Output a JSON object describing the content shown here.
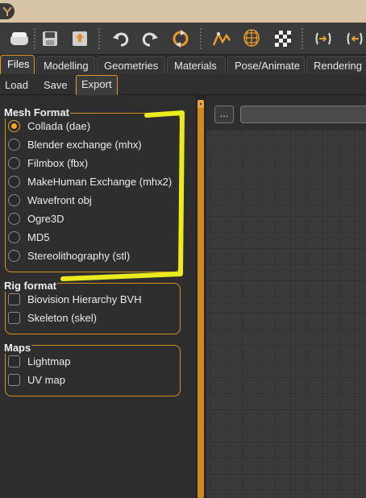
{
  "toolbar": {
    "buttons": [
      "undo-icon",
      "redo-icon",
      "reset-icon",
      "pose-icon",
      "wireframe-icon",
      "checker-icon",
      "front-view-icon",
      "back-view-icon"
    ]
  },
  "tabs": {
    "main": [
      {
        "label": "Files"
      },
      {
        "label": "Modelling"
      },
      {
        "label": "Geometries"
      },
      {
        "label": "Materials"
      },
      {
        "label": "Pose/Animate"
      },
      {
        "label": "Rendering"
      }
    ],
    "sub": [
      {
        "label": "Load"
      },
      {
        "label": "Save"
      },
      {
        "label": "Export"
      }
    ]
  },
  "mesh_format": {
    "title": "Mesh Format",
    "options": [
      {
        "label": "Collada (dae)",
        "selected": true
      },
      {
        "label": "Blender exchange (mhx)"
      },
      {
        "label": "Filmbox (fbx)"
      },
      {
        "label": "MakeHuman Exchange (mhx2)"
      },
      {
        "label": "Wavefront obj"
      },
      {
        "label": "Ogre3D"
      },
      {
        "label": "MD5"
      },
      {
        "label": "Stereolithography (stl)"
      }
    ]
  },
  "rig_format": {
    "title": "Rig format",
    "options": [
      {
        "label": "Biovision Hierarchy BVH"
      },
      {
        "label": "Skeleton (skel)"
      }
    ]
  },
  "maps": {
    "title": "Maps",
    "options": [
      {
        "label": "Lightmap"
      },
      {
        "label": "UV map"
      }
    ]
  },
  "export_path": {
    "browse_label": "...",
    "value": ""
  },
  "colors": {
    "accent": "#e09a2a",
    "highlight": "#f4f41e"
  }
}
